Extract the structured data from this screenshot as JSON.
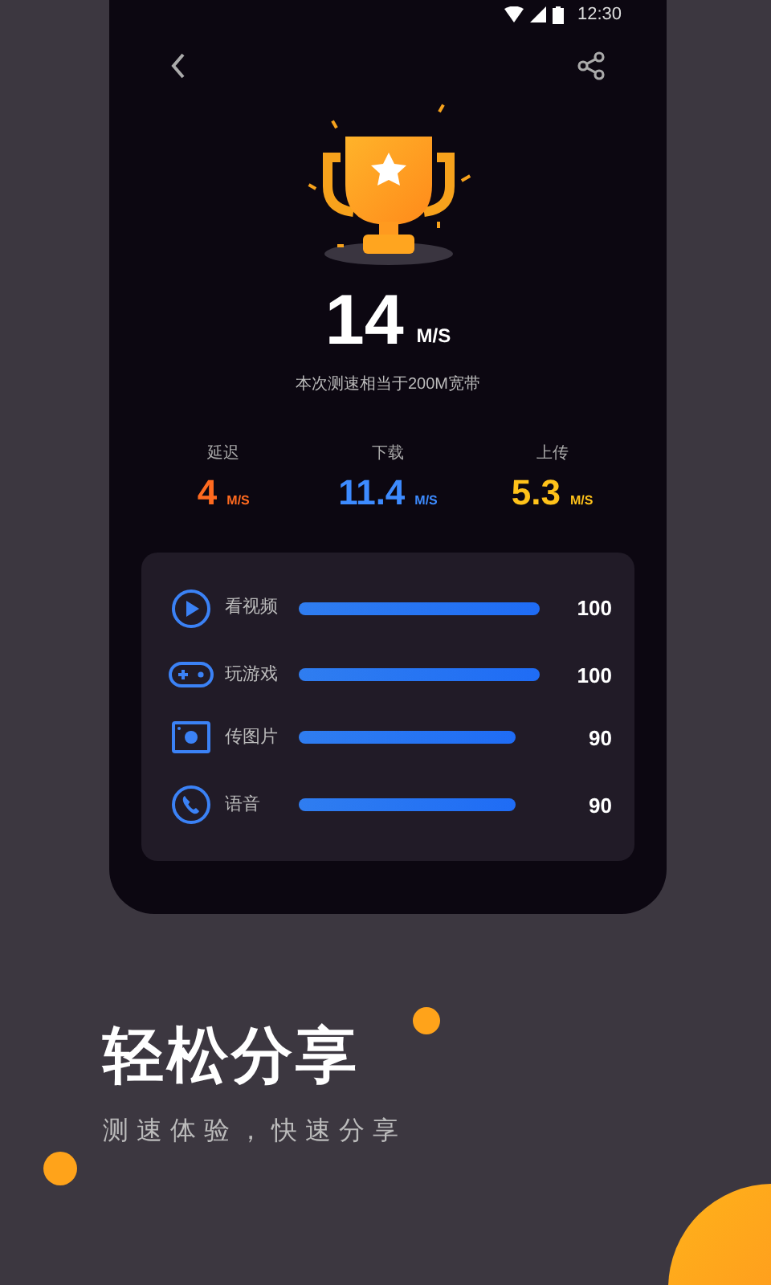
{
  "status_bar": {
    "time": "12:30"
  },
  "result": {
    "speed": "14",
    "unit": "M/S",
    "caption": "本次测速相当于200M宽带"
  },
  "stats": [
    {
      "label": "延迟",
      "value": "4",
      "unit": "M/S",
      "color": "#ff6a1f"
    },
    {
      "label": "下载",
      "value": "11.4",
      "unit": "M/S",
      "color": "#3d8bff"
    },
    {
      "label": "上传",
      "value": "5.3",
      "unit": "M/S",
      "color": "#ffc21a"
    }
  ],
  "scores": [
    {
      "kind": "video",
      "label": "看视频",
      "score": "100"
    },
    {
      "kind": "game",
      "label": "玩游戏",
      "score": "100"
    },
    {
      "kind": "photo",
      "label": "传图片",
      "score": "90"
    },
    {
      "kind": "voice",
      "label": "语音",
      "score": "90"
    }
  ],
  "promo": {
    "title": "轻松分享",
    "subtitle": "测速体验，快速分享"
  }
}
